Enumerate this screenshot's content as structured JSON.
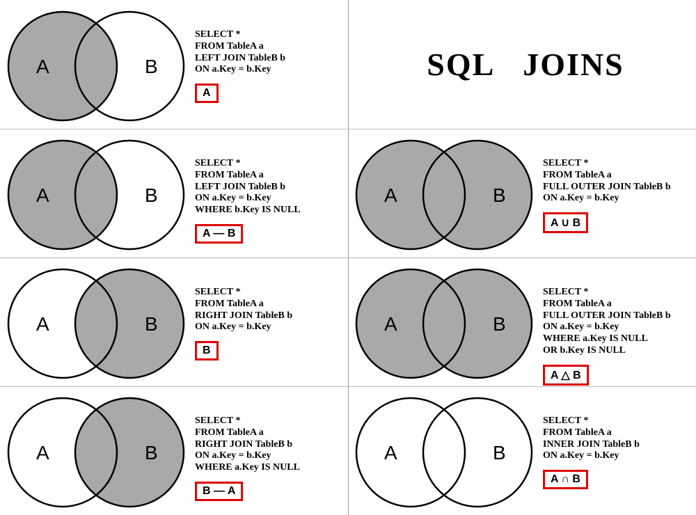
{
  "title_a": "SQL",
  "title_b": "JOINS",
  "colors": {
    "fill": "#a9a9a9",
    "stroke": "#000000",
    "badge_border": "#e00000"
  },
  "labels": {
    "A": "A",
    "B": "B"
  },
  "cells": [
    {
      "id": "left-join",
      "col": 0,
      "row": 0,
      "code": "SELECT *\nFROM TableA a\nLEFT JOIN TableB b\nON a.Key = b.Key",
      "badge": "A",
      "fill_left": true,
      "fill_right": false,
      "fill_inter": true
    },
    {
      "id": "left-join-excl",
      "col": 0,
      "row": 1,
      "code": "SELECT *\nFROM TableA a\nLEFT JOIN TableB b\nON a.Key = b.Key\nWHERE b.Key IS NULL",
      "badge": "A — B",
      "fill_left": true,
      "fill_right": false,
      "fill_inter": false
    },
    {
      "id": "right-join",
      "col": 0,
      "row": 2,
      "code": "SELECT *\nFROM TableA a\nRIGHT JOIN TableB b\nON a.Key = b.Key",
      "badge": "B",
      "fill_left": false,
      "fill_right": true,
      "fill_inter": true
    },
    {
      "id": "right-join-excl",
      "col": 0,
      "row": 3,
      "code": "SELECT *\nFROM TableA a\nRIGHT JOIN TableB b\nON a.Key = b.Key\nWHERE a.Key IS NULL",
      "badge": "B — A",
      "fill_left": false,
      "fill_right": true,
      "fill_inter": false
    },
    {
      "id": "full-outer-join",
      "col": 1,
      "row": 1,
      "code": "SELECT *\nFROM TableA a\nFULL OUTER JOIN TableB b\nON a.Key = b.Key",
      "badge": "A ∪ B",
      "fill_left": true,
      "fill_right": true,
      "fill_inter": true
    },
    {
      "id": "full-outer-join-excl",
      "col": 1,
      "row": 2,
      "code": "SELECT *\nFROM TableA a\nFULL OUTER JOIN TableB b\nON a.Key = b.Key\nWHERE a.Key IS NULL\nOR b.Key IS NULL",
      "badge": "A △ B",
      "fill_left": true,
      "fill_right": true,
      "fill_inter": false
    },
    {
      "id": "inner-join",
      "col": 1,
      "row": 3,
      "code": "SELECT *\nFROM TableA a\nINNER JOIN TableB b\nON a.Key = b.Key",
      "badge": "A ∩ B",
      "fill_left": false,
      "fill_right": false,
      "fill_inter": true
    }
  ]
}
